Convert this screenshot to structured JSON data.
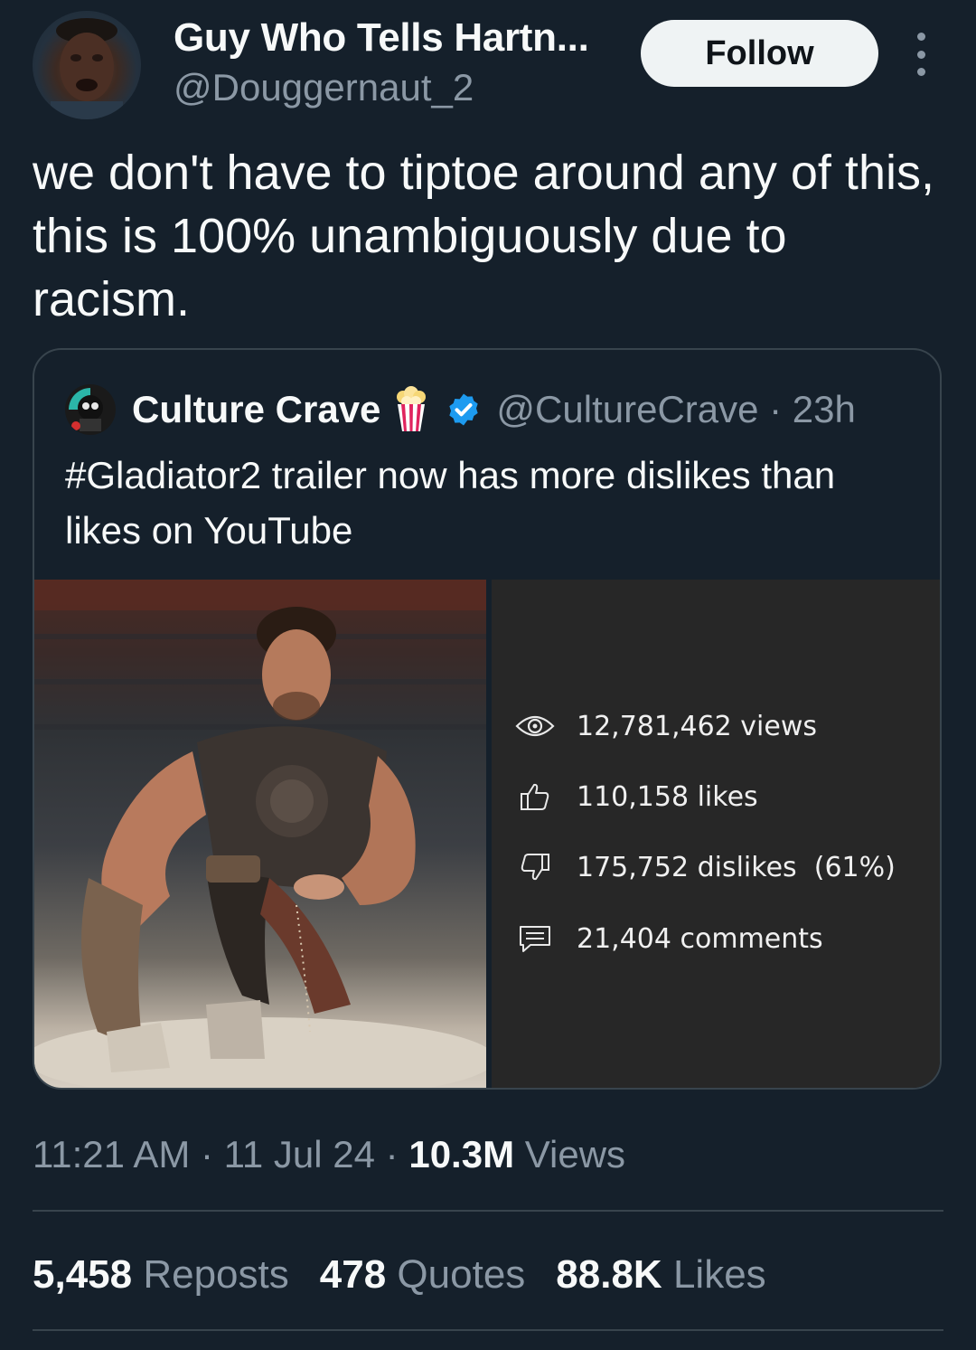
{
  "author": {
    "display_name": "Guy Who Tells Hartn...",
    "handle": "@Douggernaut_2",
    "follow_label": "Follow"
  },
  "tweet": {
    "text": "we don't have to tiptoe around any of this, this is 100% unambiguously due to racism."
  },
  "quoted": {
    "name": "Culture Crave",
    "handle_time": "@CultureCrave · 23h",
    "text": "#Gladiator2 trailer now has more dislikes than likes on YouTube",
    "stats": {
      "views": "12,781,462 views",
      "likes": "110,158 likes",
      "dislikes": "175,752 dislikes  (61%)",
      "comments": "21,404 comments"
    }
  },
  "meta": {
    "time_date": "11:21 AM · 11 Jul 24 · ",
    "views_count": "10.3M",
    "views_label": " Views"
  },
  "engagement": {
    "reposts_count": "5,458",
    "reposts_label": "Reposts",
    "quotes_count": "478",
    "quotes_label": "Quotes",
    "likes_count": "88.8K",
    "likes_label": "Likes"
  },
  "colors": {
    "background": "#15202b",
    "secondary_text": "#8b98a5",
    "border": "#38444d",
    "verified_blue": "#1d9bf0"
  },
  "icons": [
    "more-icon",
    "popcorn-icon",
    "verified-badge-icon",
    "eye-icon",
    "thumbs-up-icon",
    "thumbs-down-icon",
    "comment-icon"
  ]
}
